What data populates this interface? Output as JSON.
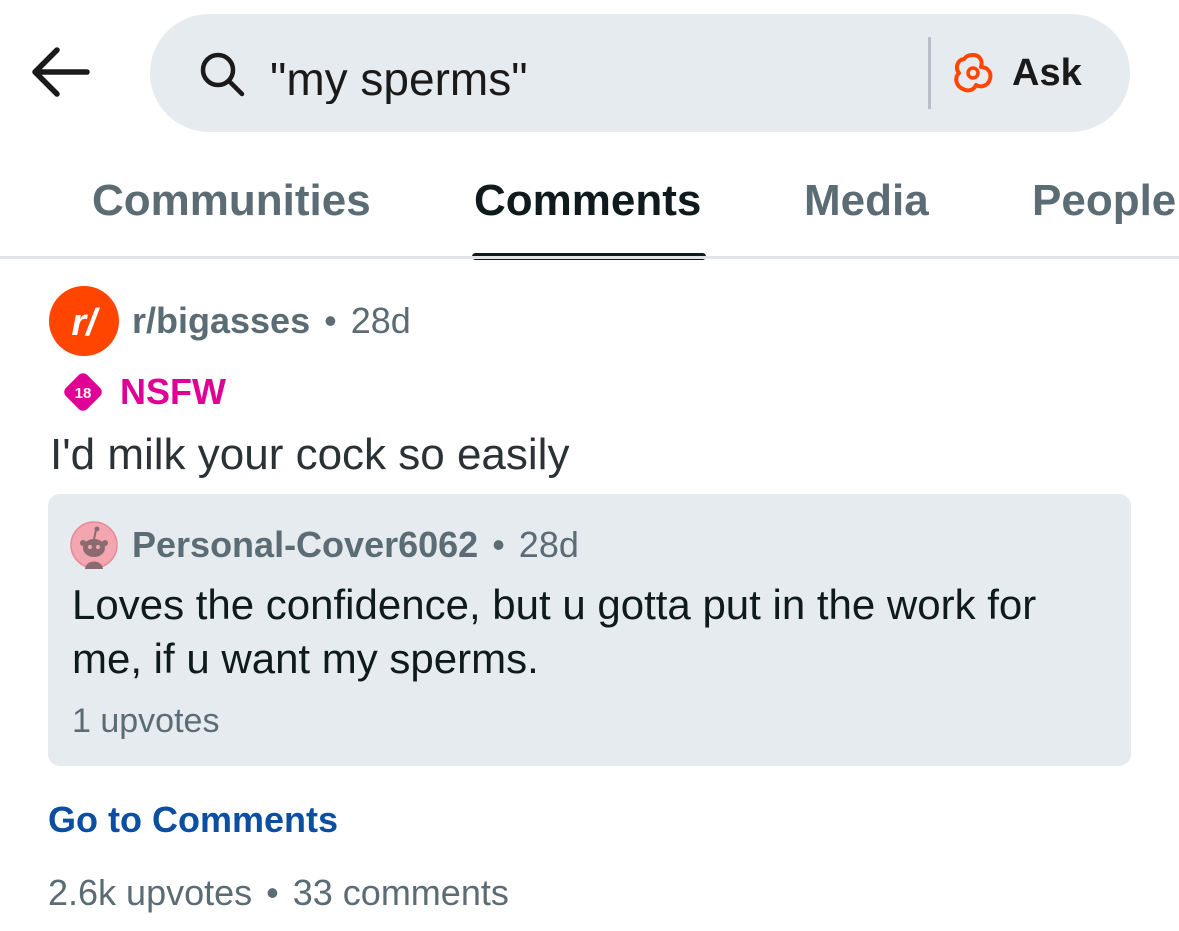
{
  "search": {
    "query": "\"my sperms\"",
    "ask_label": "Ask"
  },
  "tabs": [
    {
      "label": "Communities"
    },
    {
      "label": "Comments",
      "active": true
    },
    {
      "label": "Media"
    },
    {
      "label": "People"
    }
  ],
  "result": {
    "subreddit": "r/bigasses",
    "separator": "•",
    "post_age": "28d",
    "nsfw_badge_number": "18",
    "nsfw_label": "NSFW",
    "post_title": "I'd milk your cock so easily",
    "comment": {
      "author": "Personal-Cover6062",
      "age": "28d",
      "body": "Loves the confidence, but u gotta put in the work for me, if u want my sperms.",
      "upvotes": "1 upvotes"
    },
    "go_to_comments": "Go to Comments",
    "post_upvotes": "2.6k upvotes",
    "post_comments": "33 comments"
  },
  "colors": {
    "accent_orange": "#ff4500",
    "nsfw_pink": "#e00096",
    "link_blue": "#0b4ea2",
    "muted_gray": "#5c6c74",
    "surface_gray": "#e5ebee"
  },
  "icons": {
    "back": "arrow-left-icon",
    "search": "search-icon",
    "ask": "ask-answers-icon",
    "subreddit": "subreddit-avatar",
    "nsfw": "nsfw-18-icon",
    "user": "snoo-avatar"
  }
}
